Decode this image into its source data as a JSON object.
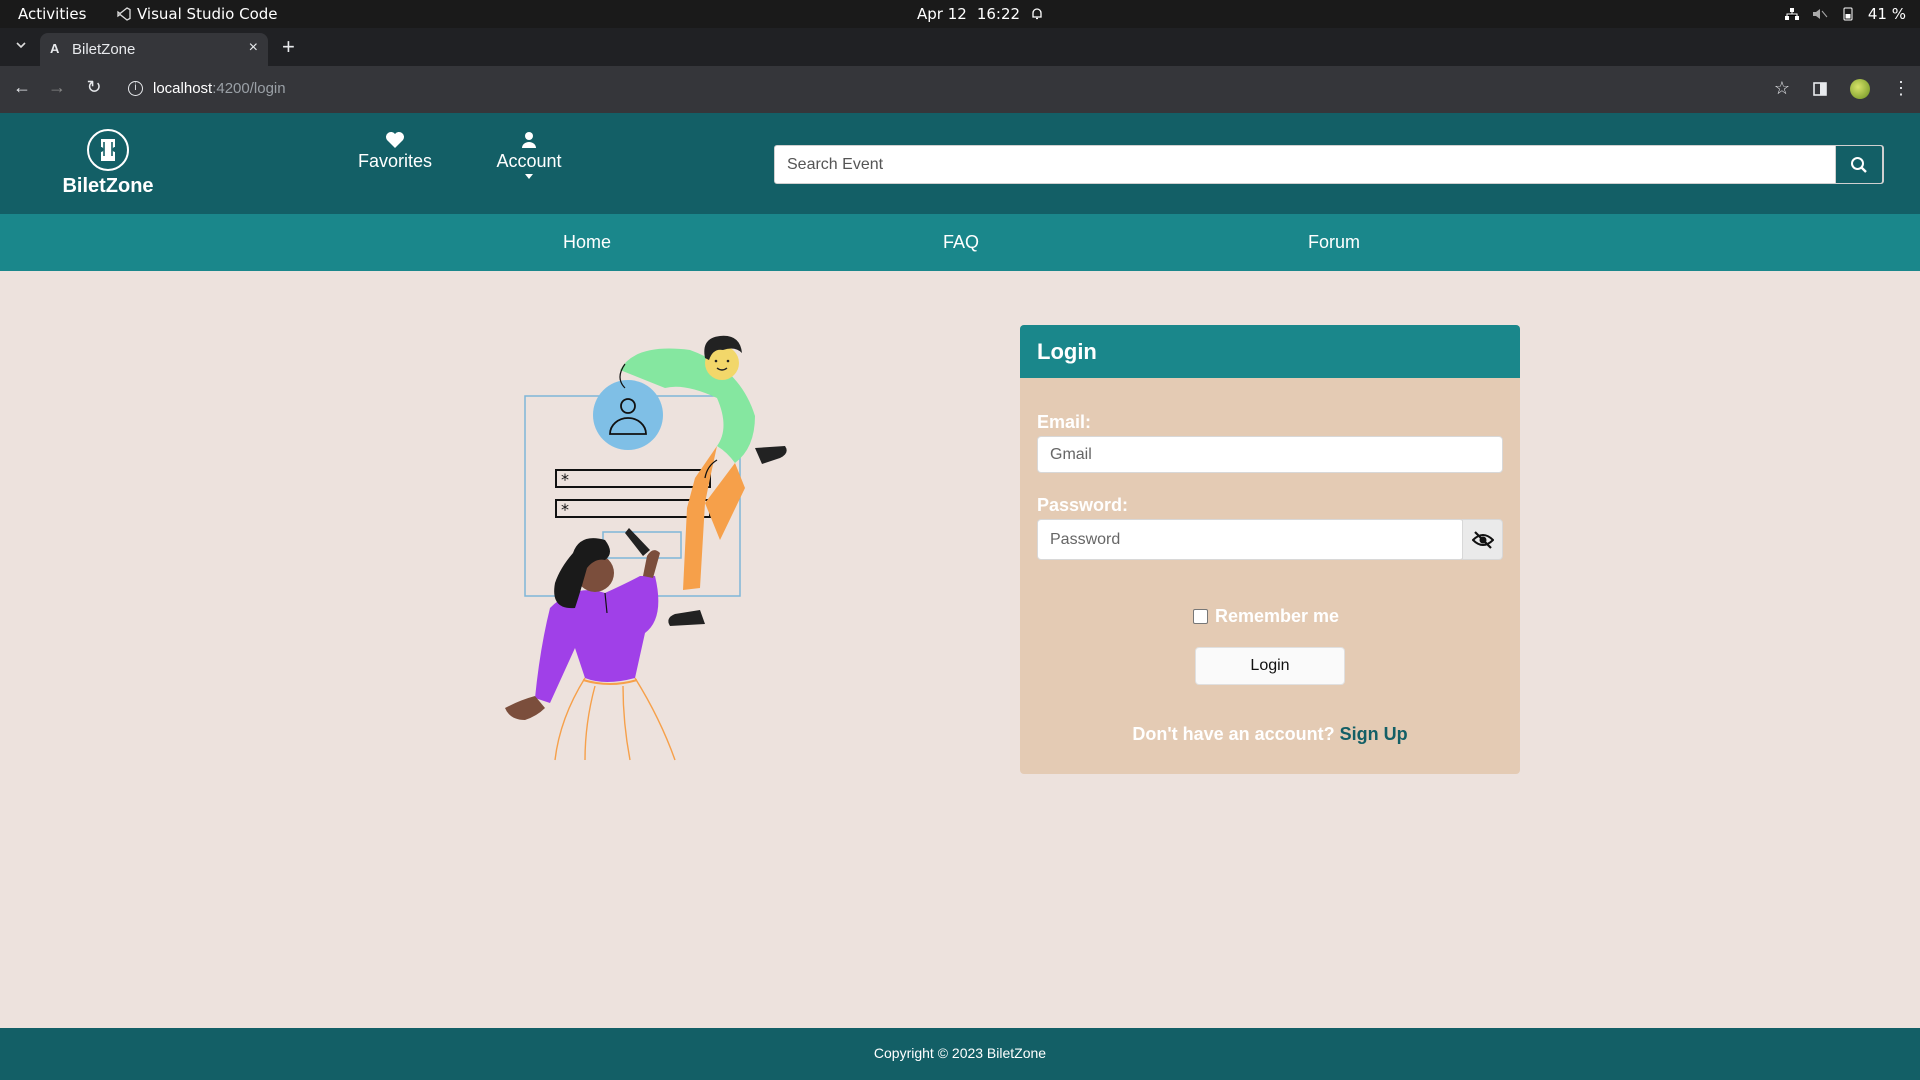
{
  "os": {
    "activities": "Activities",
    "app_name": "Visual Studio Code",
    "date": "Apr 12",
    "time": "16:22",
    "battery": "41 %"
  },
  "browser": {
    "tab_title": "BiletZone",
    "tab_favicon": "A",
    "url_host": "localhost",
    "url_path": ":4200/login"
  },
  "header": {
    "brand": "BiletZone",
    "favorites": "Favorites",
    "account": "Account",
    "search_placeholder": "Search Event"
  },
  "subnav": {
    "home": "Home",
    "faq": "FAQ",
    "forum": "Forum"
  },
  "login": {
    "title": "Login",
    "email_label": "Email:",
    "email_placeholder": "Gmail",
    "password_label": "Password:",
    "password_placeholder": "Password",
    "remember": "Remember me",
    "button": "Login",
    "no_account": "Don't have an account?",
    "signup": "Sign Up"
  },
  "footer": {
    "copyright": "Copyright © 2023 BiletZone"
  },
  "colors": {
    "header_bg": "#135f66",
    "subnav_bg": "#1a878b",
    "card_bg": "#e4cbb4",
    "page_bg": "#ede2dd"
  }
}
